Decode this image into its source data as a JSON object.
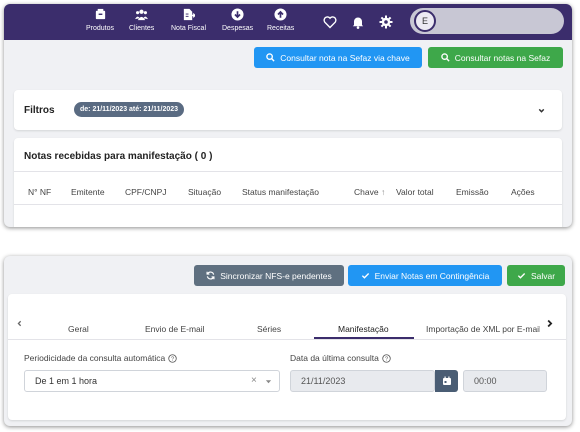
{
  "topnav": {
    "items": [
      {
        "label": "Produtos",
        "icon": "box-icon"
      },
      {
        "label": "Clientes",
        "icon": "users-icon"
      },
      {
        "label": "Nota Fiscal",
        "icon": "invoice-icon"
      },
      {
        "label": "Despesas",
        "icon": "arrow-down-circle-icon"
      },
      {
        "label": "Receitas",
        "icon": "arrow-up-circle-icon"
      }
    ],
    "avatar_letter": "E"
  },
  "toolbar1": {
    "consultar_chave_label": "Consultar nota na Sefaz via chave",
    "consultar_notas_label": "Consultar notas na Sefaz"
  },
  "filters": {
    "title": "Filtros",
    "chip": "de: 21/11/2023 até: 21/11/2023"
  },
  "notas": {
    "title": "Notas recebidas para manifestação ( 0 )",
    "columns": [
      "N° NF",
      "Emitente",
      "CPF/CNPJ",
      "Situação",
      "Status manifestação",
      "Chave",
      "Valor total",
      "Emissão",
      "Ações"
    ]
  },
  "toolbar2": {
    "sincronizar_label": "Sincronizar NFS-e pendentes",
    "enviar_label": "Enviar Notas em Contingência",
    "salvar_label": "Salvar"
  },
  "tabs": [
    "Geral",
    "Envio de E-mail",
    "Séries",
    "Manifestação",
    "Importação de XML por E-mail"
  ],
  "active_tab": "Manifestação",
  "form": {
    "periodicidade_label": "Periodicidade da consulta automática",
    "periodicidade_value": "De 1 em 1 hora",
    "ultima_label": "Data da última consulta",
    "ultima_date": "21/11/2023",
    "ultima_time": "00:00"
  },
  "colors": {
    "nav_bg": "#3b2d6c",
    "blue": "#2196f3",
    "green": "#3ea84a",
    "gray": "#5f7080",
    "chip": "#5a6b82"
  }
}
